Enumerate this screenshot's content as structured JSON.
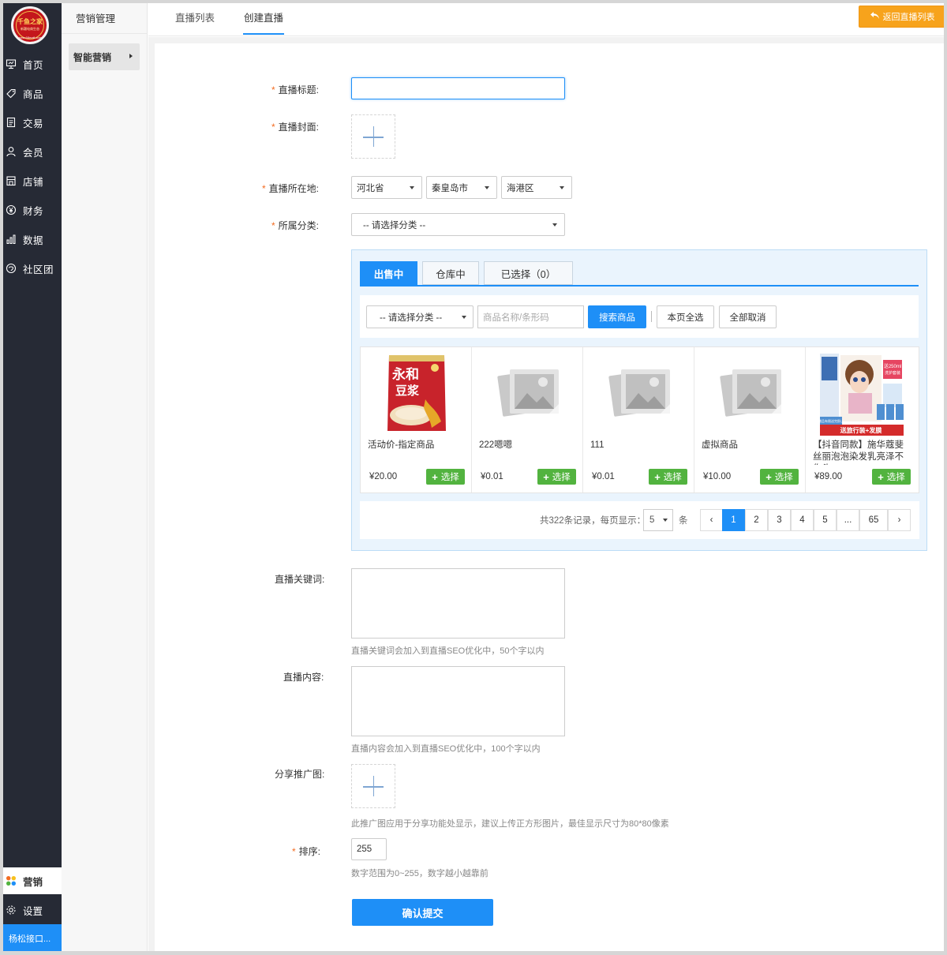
{
  "brand": {
    "logo_text": "千鱼之家",
    "logo_subtext": "新疆电商生态",
    "logo_url_text": "www.68mall.com"
  },
  "sidebar": {
    "items": [
      {
        "label": "首页",
        "icon": "monitor-icon"
      },
      {
        "label": "商品",
        "icon": "tag-icon"
      },
      {
        "label": "交易",
        "icon": "document-icon"
      },
      {
        "label": "会员",
        "icon": "user-icon"
      },
      {
        "label": "店铺",
        "icon": "shop-icon"
      },
      {
        "label": "财务",
        "icon": "yen-icon"
      },
      {
        "label": "数据",
        "icon": "bar-chart-icon"
      },
      {
        "label": "社区团",
        "icon": "community-icon"
      }
    ],
    "marketing_label": "营销",
    "settings_label": "设置",
    "user_label": "杨松接口..."
  },
  "subnav": {
    "title": "营销管理",
    "active_item": "智能营销"
  },
  "topbar": {
    "tabs": [
      {
        "label": "直播列表"
      },
      {
        "label": "创建直播"
      }
    ],
    "active_tab": "创建直播",
    "back_button": "返回直播列表"
  },
  "form": {
    "title_label": "直播标题:",
    "title_value": "",
    "cover_label": "直播封面:",
    "location_label": "直播所在地:",
    "province": "河北省",
    "city": "秦皇岛市",
    "district": "海港区",
    "category_label": "所属分类:",
    "category_value": "-- 请选择分类 --",
    "keywords_label": "直播关键词:",
    "keywords_hint": "直播关键词会加入到直播SEO优化中，50个字以内",
    "content_label": "直播内容:",
    "content_hint": "直播内容会加入到直播SEO优化中，100个字以内",
    "share_label": "分享推广图:",
    "share_hint": "此推广图应用于分享功能处显示，建议上传正方形图片，最佳显示尺寸为80*80像素",
    "sort_label": "排序:",
    "sort_value": "255",
    "sort_hint": "数字范围为0~255，数字越小越靠前",
    "submit_label": "确认提交"
  },
  "picker": {
    "tabs": [
      {
        "label": "出售中"
      },
      {
        "label": "仓库中"
      },
      {
        "label": "已选择（0）"
      }
    ],
    "active_tab": "出售中",
    "category_select": "-- 请选择分类 --",
    "search_placeholder": "商品名称/条形码",
    "search_button": "搜索商品",
    "select_page_button": "本页全选",
    "cancel_all_button": "全部取消",
    "goods": [
      {
        "name": "活动价-指定商品",
        "price": "¥20.00",
        "image": "soy-milk-package",
        "select_label": "选择"
      },
      {
        "name": "222嗯嗯",
        "price": "¥0.01",
        "image": "placeholder-image",
        "select_label": "选择"
      },
      {
        "name": "111",
        "price": "¥0.01",
        "image": "placeholder-image",
        "select_label": "选择"
      },
      {
        "name": "虚拟商品",
        "price": "¥10.00",
        "image": "placeholder-image",
        "select_label": "选择"
      },
      {
        "name": "【抖音同款】施华蔻斐丝丽泡泡染发乳亮泽不伤头",
        "price": "¥89.00",
        "image": "hair-dye-box",
        "select_label": "选择"
      }
    ],
    "product_banner_text": "送旅行装+发膜",
    "product_banner_small": "赠品有限送完即止",
    "product_badge_text": "送250ml洗护套装",
    "pagination": {
      "summary": "共322条记录，每页显示：",
      "page_size": "5",
      "unit": "条",
      "prev": "‹",
      "next": "›",
      "pages": [
        "1",
        "2",
        "3",
        "4",
        "5",
        "...",
        "65"
      ],
      "current": "1"
    }
  },
  "colors": {
    "sidebar_bg": "#262a35",
    "primary": "#1e8ff7",
    "orange": "#f7a31c",
    "green": "#52b33f",
    "required": "#f36c21"
  }
}
